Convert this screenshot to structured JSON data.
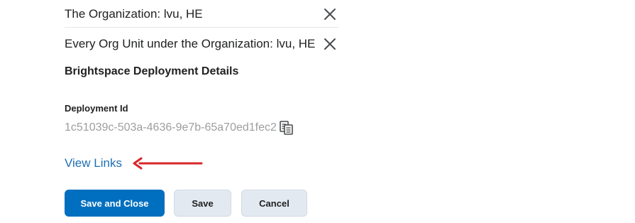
{
  "org_units": [
    {
      "label": "The Organization: lvu, HE",
      "remove_icon": "close-icon"
    },
    {
      "label": "Every Org Unit under the Organization: lvu, HE",
      "remove_icon": "close-icon"
    }
  ],
  "deployment_section": {
    "heading": "Brightspace Deployment Details",
    "deployment_id_label": "Deployment Id",
    "deployment_id_value": "1c51039c-503a-4636-9e7b-65a70ed1fec2",
    "copy_icon": "copy-icon"
  },
  "view_links_label": "View Links",
  "annotation_arrow_color": "#d9262b",
  "buttons": {
    "save_and_close": "Save and Close",
    "save": "Save",
    "cancel": "Cancel"
  },
  "colors": {
    "primary": "#006fbf",
    "link": "#1e6fb4",
    "secondary_button_bg": "#e3e9f1",
    "muted_text": "#9c9ea1"
  }
}
